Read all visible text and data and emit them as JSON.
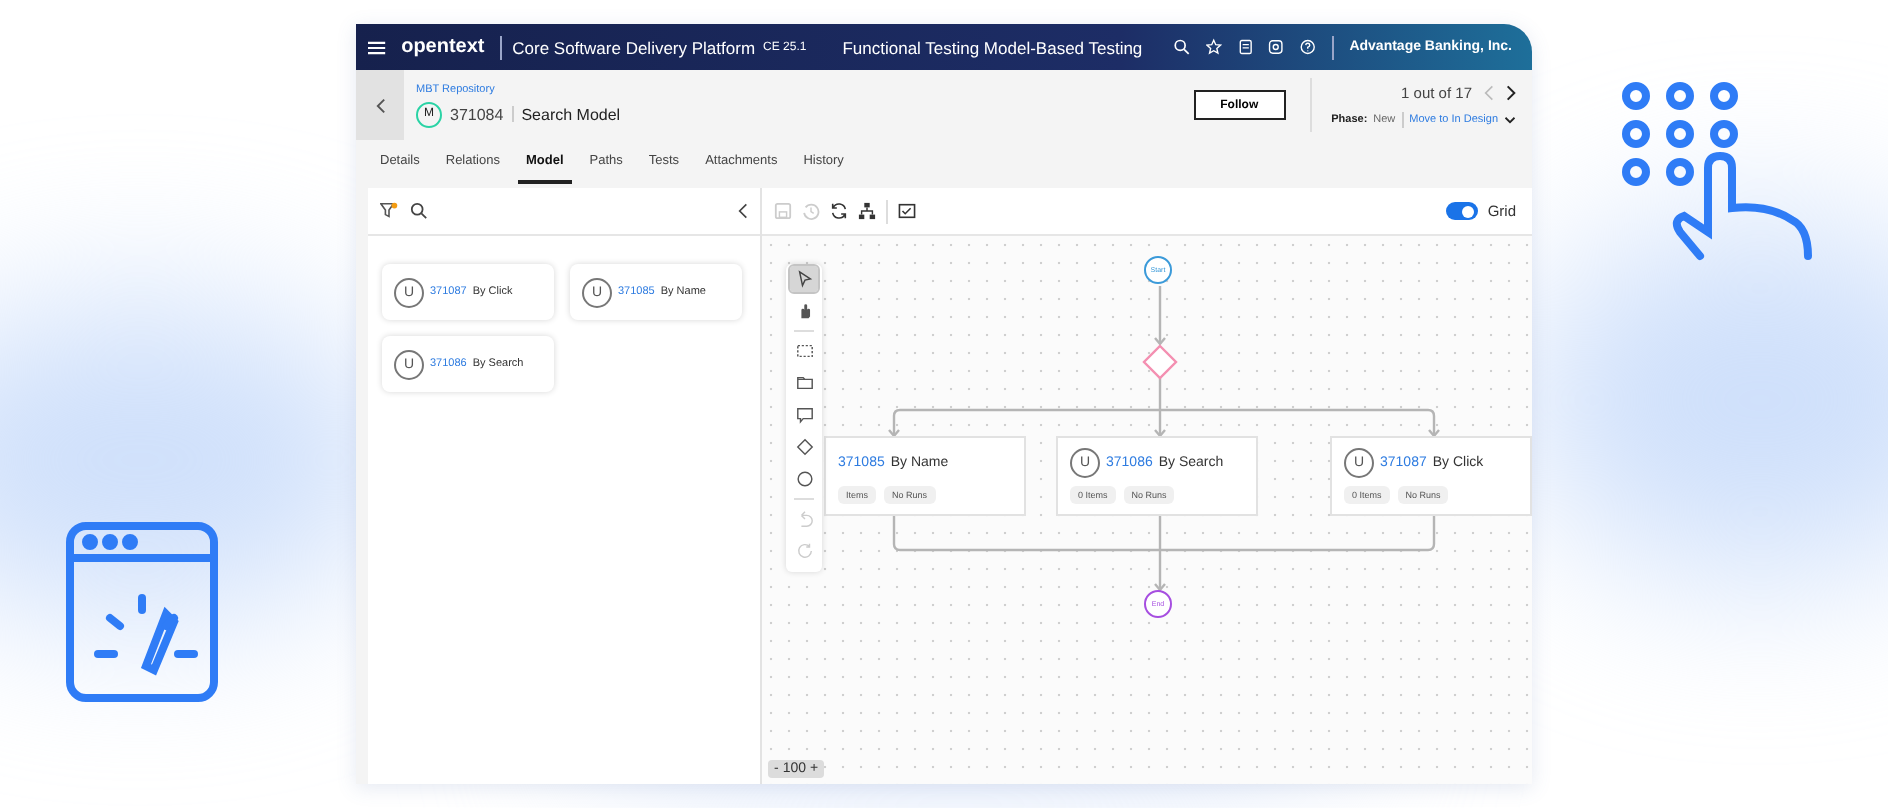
{
  "header": {
    "logo": "opentext",
    "product": "Core Software Delivery Platform",
    "version": "CE 25.1",
    "module": "Functional Testing Model-Based Testing",
    "workspace": "Advantage Banking, Inc."
  },
  "entity": {
    "breadcrumb": "MBT Repository",
    "type_badge": "M",
    "id": "371084",
    "name": "Search Model",
    "follow": "Follow",
    "pager": "1 out of 17",
    "phase_label": "Phase:",
    "phase": "New",
    "transition": "Move to In Design"
  },
  "tabs": [
    {
      "label": "Details",
      "selected": false
    },
    {
      "label": "Relations",
      "selected": false
    },
    {
      "label": "Model",
      "selected": true
    },
    {
      "label": "Paths",
      "selected": false
    },
    {
      "label": "Tests",
      "selected": false
    },
    {
      "label": "Attachments",
      "selected": false
    },
    {
      "label": "History",
      "selected": false
    }
  ],
  "units": [
    {
      "avatar": "U",
      "id": "371087",
      "name": "By Click"
    },
    {
      "avatar": "U",
      "id": "371085",
      "name": "By Name"
    },
    {
      "avatar": "U",
      "id": "371086",
      "name": "By Search"
    }
  ],
  "canvas": {
    "grid_label": "Grid",
    "grid_on": true,
    "start": "Start",
    "end": "End",
    "tools": [
      {
        "kind": "pointer",
        "selected": true
      },
      {
        "kind": "hand",
        "selected": false
      },
      {
        "kind": "sep"
      },
      {
        "kind": "marquee",
        "selected": false
      },
      {
        "kind": "frame",
        "selected": false
      },
      {
        "kind": "comment",
        "selected": false
      },
      {
        "kind": "diamond",
        "selected": false
      },
      {
        "kind": "circle",
        "selected": false
      },
      {
        "kind": "sep"
      },
      {
        "kind": "undo",
        "selected": false
      },
      {
        "kind": "redo",
        "selected": false
      }
    ],
    "nodes": [
      {
        "id": "371085",
        "name": "By Name",
        "items": "Items",
        "runs": "No Runs"
      },
      {
        "avatar": "U",
        "id": "371086",
        "name": "By Search",
        "items": "0 Items",
        "runs": "No Runs"
      },
      {
        "avatar": "U",
        "id": "371087",
        "name": "By Click",
        "items": "0 Items",
        "runs": "No Runs"
      }
    ],
    "zoom": {
      "minus": "-",
      "value": "100",
      "plus": "+"
    }
  }
}
